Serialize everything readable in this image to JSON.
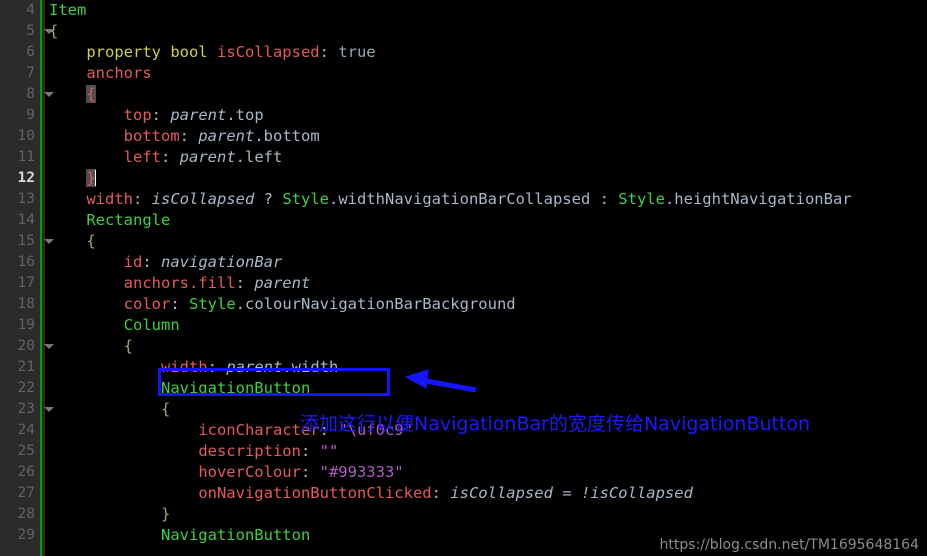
{
  "editor": {
    "theme_background": "#000000",
    "gutter_background": "#2b2b2b",
    "gutter_rule_color": "#00a000",
    "current_line_number": "12",
    "first_visible_line": "4",
    "last_visible_line": "29"
  },
  "lines": [
    {
      "no": "4",
      "fold": false,
      "current": false,
      "indent": 0,
      "tokens": [
        {
          "text": "Item",
          "cls": "t-type"
        }
      ]
    },
    {
      "no": "5",
      "fold": true,
      "current": false,
      "indent": 0,
      "tokens": [
        {
          "text": "{",
          "cls": "t-brace"
        }
      ]
    },
    {
      "no": "6",
      "fold": false,
      "current": false,
      "indent": 1,
      "tokens": [
        {
          "text": "property bool ",
          "cls": "t-kw"
        },
        {
          "text": "isCollapsed",
          "cls": "t-prop"
        },
        {
          "text": ": ",
          "cls": "t-punc"
        },
        {
          "text": "true",
          "cls": "t-val"
        }
      ]
    },
    {
      "no": "7",
      "fold": false,
      "current": false,
      "indent": 1,
      "tokens": [
        {
          "text": "anchors",
          "cls": "t-prop"
        }
      ]
    },
    {
      "no": "8",
      "fold": true,
      "current": false,
      "indent": 1,
      "tokens": [
        {
          "text": "{",
          "cls": "t-prop brace-match"
        }
      ]
    },
    {
      "no": "9",
      "fold": false,
      "current": false,
      "indent": 2,
      "tokens": [
        {
          "text": "top",
          "cls": "t-prop"
        },
        {
          "text": ": ",
          "cls": "t-punc"
        },
        {
          "text": "parent",
          "cls": "t-ital"
        },
        {
          "text": ".top",
          "cls": "t-punc"
        }
      ]
    },
    {
      "no": "10",
      "fold": false,
      "current": false,
      "indent": 2,
      "tokens": [
        {
          "text": "bottom",
          "cls": "t-prop"
        },
        {
          "text": ": ",
          "cls": "t-punc"
        },
        {
          "text": "parent",
          "cls": "t-ital"
        },
        {
          "text": ".bottom",
          "cls": "t-punc"
        }
      ]
    },
    {
      "no": "11",
      "fold": false,
      "current": false,
      "indent": 2,
      "tokens": [
        {
          "text": "left",
          "cls": "t-prop"
        },
        {
          "text": ": ",
          "cls": "t-punc"
        },
        {
          "text": "parent",
          "cls": "t-ital"
        },
        {
          "text": ".left",
          "cls": "t-punc"
        }
      ]
    },
    {
      "no": "12",
      "fold": false,
      "current": true,
      "indent": 1,
      "caret": true,
      "tokens": [
        {
          "text": "}",
          "cls": "t-prop brace-match"
        }
      ]
    },
    {
      "no": "13",
      "fold": false,
      "current": false,
      "indent": 1,
      "tokens": [
        {
          "text": "width",
          "cls": "t-prop"
        },
        {
          "text": ": ",
          "cls": "t-punc"
        },
        {
          "text": "isCollapsed",
          "cls": "t-ital"
        },
        {
          "text": " ? ",
          "cls": "t-op"
        },
        {
          "text": "Style",
          "cls": "t-type"
        },
        {
          "text": ".widthNavigationBarCollapsed : ",
          "cls": "t-punc"
        },
        {
          "text": "Style",
          "cls": "t-type"
        },
        {
          "text": ".heightNavigationBar",
          "cls": "t-punc"
        }
      ]
    },
    {
      "no": "14",
      "fold": false,
      "current": false,
      "indent": 1,
      "tokens": [
        {
          "text": "Rectangle",
          "cls": "t-type"
        }
      ]
    },
    {
      "no": "15",
      "fold": true,
      "current": false,
      "indent": 1,
      "tokens": [
        {
          "text": "{",
          "cls": "t-brace"
        }
      ]
    },
    {
      "no": "16",
      "fold": false,
      "current": false,
      "indent": 2,
      "tokens": [
        {
          "text": "id",
          "cls": "t-prop"
        },
        {
          "text": ": ",
          "cls": "t-punc"
        },
        {
          "text": "navigationBar",
          "cls": "t-ital"
        }
      ]
    },
    {
      "no": "17",
      "fold": false,
      "current": false,
      "indent": 2,
      "tokens": [
        {
          "text": "anchors.fill",
          "cls": "t-prop"
        },
        {
          "text": ": ",
          "cls": "t-punc"
        },
        {
          "text": "parent",
          "cls": "t-ital"
        }
      ]
    },
    {
      "no": "18",
      "fold": false,
      "current": false,
      "indent": 2,
      "tokens": [
        {
          "text": "color",
          "cls": "t-prop"
        },
        {
          "text": ": ",
          "cls": "t-punc"
        },
        {
          "text": "Style",
          "cls": "t-type"
        },
        {
          "text": ".colourNavigationBarBackground",
          "cls": "t-punc"
        }
      ]
    },
    {
      "no": "19",
      "fold": false,
      "current": false,
      "indent": 2,
      "tokens": [
        {
          "text": "Column",
          "cls": "t-type"
        }
      ]
    },
    {
      "no": "20",
      "fold": true,
      "current": false,
      "indent": 2,
      "tokens": [
        {
          "text": "{",
          "cls": "t-brace"
        }
      ]
    },
    {
      "no": "21",
      "fold": false,
      "current": false,
      "indent": 3,
      "tokens": [
        {
          "text": "width",
          "cls": "t-prop"
        },
        {
          "text": ": ",
          "cls": "t-punc"
        },
        {
          "text": "parent",
          "cls": "t-ital"
        },
        {
          "text": ".width",
          "cls": "t-punc"
        }
      ]
    },
    {
      "no": "22",
      "fold": false,
      "current": false,
      "indent": 3,
      "tokens": [
        {
          "text": "NavigationButton",
          "cls": "t-type"
        }
      ]
    },
    {
      "no": "23",
      "fold": true,
      "current": false,
      "indent": 3,
      "tokens": [
        {
          "text": "{",
          "cls": "t-brace"
        }
      ]
    },
    {
      "no": "24",
      "fold": false,
      "current": false,
      "indent": 4,
      "tokens": [
        {
          "text": "iconCharacter",
          "cls": "t-prop"
        },
        {
          "text": ": ",
          "cls": "t-punc"
        },
        {
          "text": "\"\\uf0c9\"",
          "cls": "t-str"
        }
      ]
    },
    {
      "no": "25",
      "fold": false,
      "current": false,
      "indent": 4,
      "tokens": [
        {
          "text": "description",
          "cls": "t-prop"
        },
        {
          "text": ": ",
          "cls": "t-punc"
        },
        {
          "text": "\"\"",
          "cls": "t-str"
        }
      ]
    },
    {
      "no": "26",
      "fold": false,
      "current": false,
      "indent": 4,
      "tokens": [
        {
          "text": "hoverColour",
          "cls": "t-prop"
        },
        {
          "text": ": ",
          "cls": "t-punc"
        },
        {
          "text": "\"#993333\"",
          "cls": "t-str"
        }
      ]
    },
    {
      "no": "27",
      "fold": false,
      "current": false,
      "indent": 4,
      "tokens": [
        {
          "text": "onNavigationButtonClicked",
          "cls": "t-prop"
        },
        {
          "text": ": ",
          "cls": "t-punc"
        },
        {
          "text": "isCollapsed",
          "cls": "t-ital"
        },
        {
          "text": " = ",
          "cls": "t-op"
        },
        {
          "text": "!isCollapsed",
          "cls": "t-ital"
        }
      ]
    },
    {
      "no": "28",
      "fold": false,
      "current": false,
      "indent": 3,
      "tokens": [
        {
          "text": "}",
          "cls": "t-brace"
        }
      ]
    },
    {
      "no": "29",
      "fold": false,
      "current": false,
      "indent": 3,
      "tokens": [
        {
          "text": "NavigationButton",
          "cls": "t-type"
        }
      ]
    }
  ],
  "annotations": {
    "highlight_box": {
      "label": "width: parent.width",
      "color": "#1414ff"
    },
    "arrow": {
      "direction": "left",
      "color": "#1414ff"
    },
    "note": {
      "text": "添加这行以便NavigationBar的宽度传给NavigationButton",
      "color": "#1a1aff"
    }
  },
  "watermark": {
    "text": "https://blog.csdn.net/TM1695648164"
  }
}
